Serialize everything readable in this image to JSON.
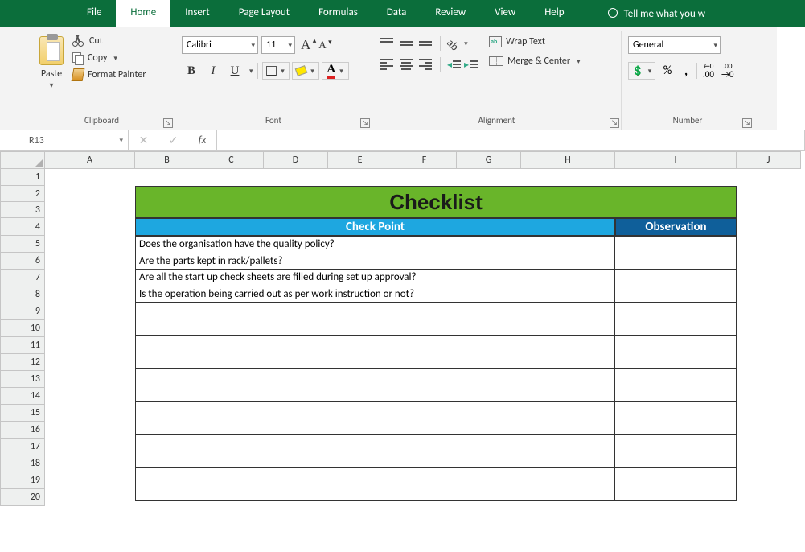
{
  "tabs": {
    "file": "File",
    "home": "Home",
    "insert": "Insert",
    "pagelayout": "Page Layout",
    "formulas": "Formulas",
    "data": "Data",
    "review": "Review",
    "view": "View",
    "help": "Help",
    "tellme": "Tell me what you w"
  },
  "clipboard": {
    "paste": "Paste",
    "cut": "Cut",
    "copy": "Copy",
    "painter": "Format Painter",
    "group_label": "Clipboard"
  },
  "font": {
    "name": "Calibri",
    "size": "11",
    "bold": "B",
    "italic": "I",
    "underline": "U",
    "group_label": "Font"
  },
  "alignment": {
    "wrap": "Wrap Text",
    "merge": "Merge & Center",
    "group_label": "Alignment"
  },
  "number": {
    "format": "General",
    "group_label": "Number"
  },
  "namebox": "R13",
  "fx_label": "fx",
  "columns": [
    "A",
    "B",
    "C",
    "D",
    "E",
    "F",
    "G",
    "H",
    "I",
    "J"
  ],
  "rows": [
    "1",
    "2",
    "3",
    "4",
    "5",
    "6",
    "7",
    "8",
    "9",
    "10",
    "11",
    "12",
    "13",
    "14",
    "15",
    "16",
    "17",
    "18",
    "19",
    "20"
  ],
  "sheet": {
    "title": "Checklist",
    "header_point": "Check Point",
    "header_obs": "Observation",
    "items": [
      "Does the organisation have the quality policy?",
      "Are the parts kept in rack/pallets?",
      "Are all the start up check sheets are filled during set up approval?",
      "Is the operation being carried out as per work instruction or not?",
      "",
      "",
      "",
      "",
      "",
      "",
      "",
      "",
      "",
      "",
      "",
      ""
    ]
  }
}
